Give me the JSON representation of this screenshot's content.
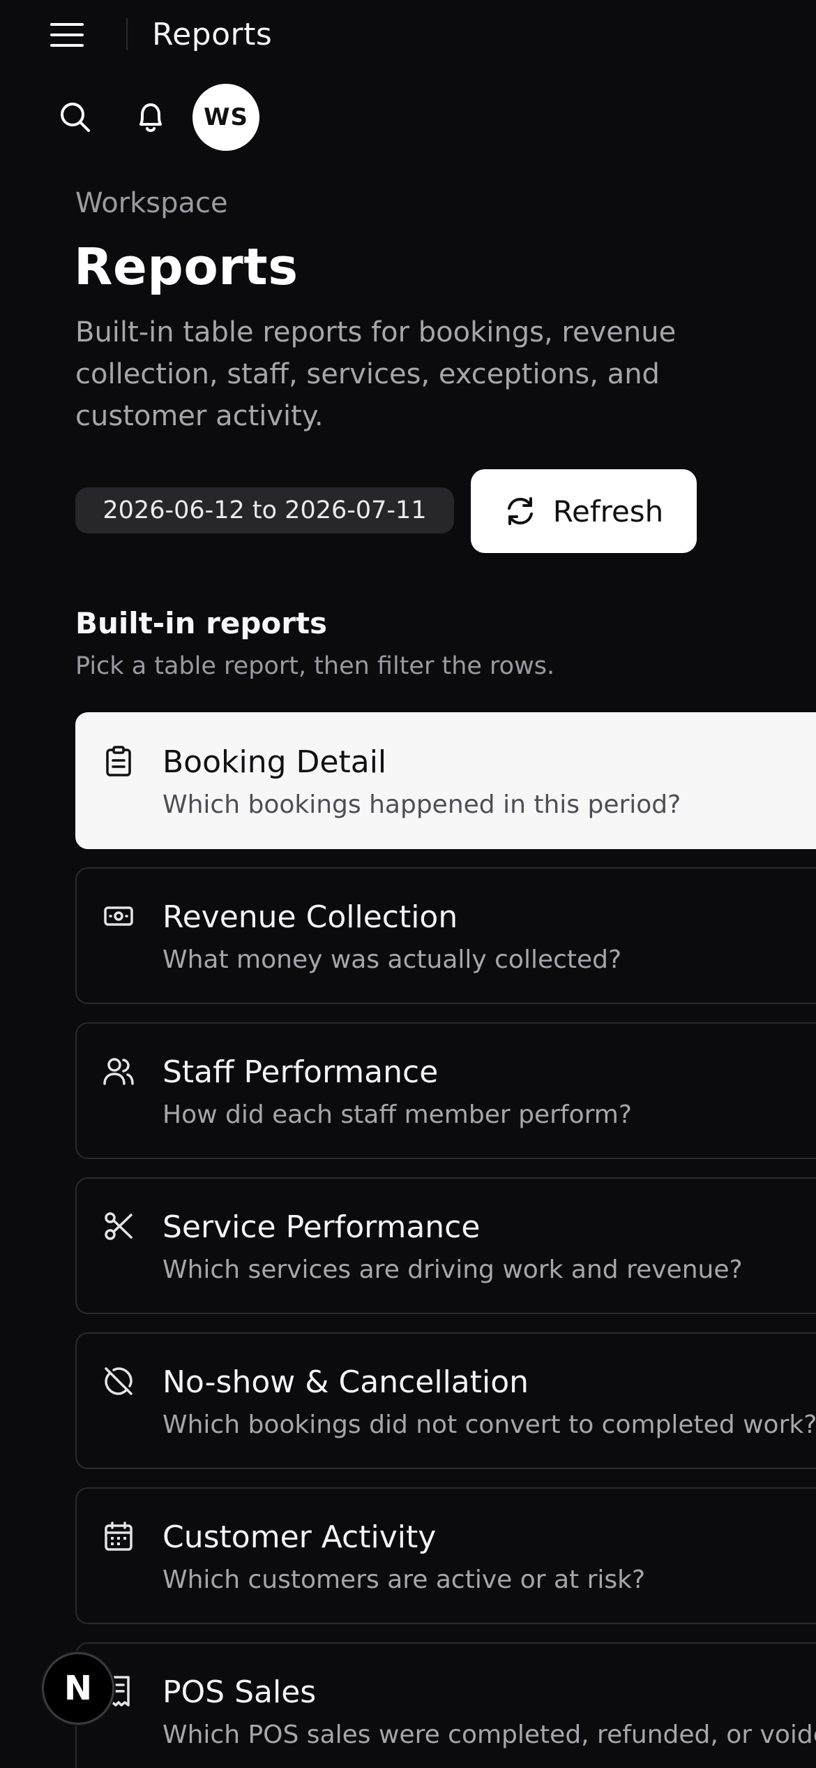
{
  "topbar": {
    "title": "Reports"
  },
  "header": {
    "avatar_initials": "WS",
    "icons": [
      "menu-icon",
      "search-icon",
      "bell-icon"
    ]
  },
  "intro": {
    "eyebrow": "Workspace",
    "title": "Reports",
    "description": "Built-in table reports for bookings, revenue collection, staff, services, exceptions, and customer activity.",
    "date_range": "2026-06-12 to 2026-07-11",
    "refresh_label": "Refresh"
  },
  "section": {
    "title": "Built-in reports",
    "subtitle": "Pick a table report, then filter the rows."
  },
  "reports": [
    {
      "title": "Booking Detail",
      "description": "Which bookings happened in this period?",
      "icon": "clipboard-icon",
      "selected": true
    },
    {
      "title": "Revenue Collection",
      "description": "What money was actually collected?",
      "icon": "banknote-icon",
      "selected": false
    },
    {
      "title": "Staff Performance",
      "description": "How did each staff member perform?",
      "icon": "users-icon",
      "selected": false
    },
    {
      "title": "Service Performance",
      "description": "Which services are driving work and revenue?",
      "icon": "scissors-icon",
      "selected": false
    },
    {
      "title": "No-show & Cancellation",
      "description": "Which bookings did not convert to completed work?",
      "icon": "ban-icon",
      "selected": false
    },
    {
      "title": "Customer Activity",
      "description": "Which customers are active or at risk?",
      "icon": "calendar-icon",
      "selected": false
    },
    {
      "title": "POS Sales",
      "description": "Which POS sales were completed, refunded, or voided?",
      "icon": "receipt-icon",
      "selected": false
    }
  ],
  "floating_badge": {
    "label": "N"
  },
  "colors": {
    "background": "#0b0b0d",
    "card_border": "#2a2a2f",
    "selected_card": "#f7f7f8",
    "muted_text": "#a6a6ad",
    "chip_bg": "#27272b"
  }
}
